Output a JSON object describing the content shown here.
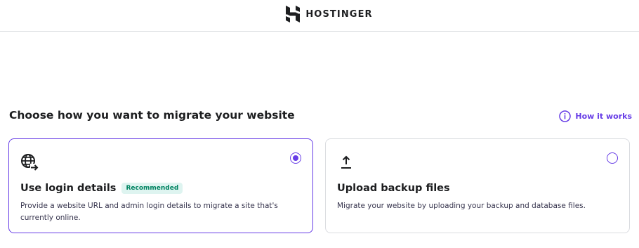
{
  "header": {
    "brand": "HOSTINGER",
    "logo_icon": "hostinger-logo-icon"
  },
  "section": {
    "title": "Choose how you want to migrate your website",
    "help_link": "How it works",
    "help_icon": "info-circle-icon"
  },
  "options": [
    {
      "title": "Use login details",
      "badge": "Recommended",
      "description": "Provide a website URL and admin login details to migrate a site that's currently online.",
      "icon": "globe-arrow-icon",
      "selected": true
    },
    {
      "title": "Upload backup files",
      "description": "Migrate your website by uploading your backup and database files.",
      "icon": "upload-arrow-icon",
      "selected": false
    }
  ],
  "colors": {
    "accent": "#673de6",
    "badge_bg": "#def4f0",
    "badge_text": "#008361",
    "border": "#dadce0",
    "text": "#1d1e20"
  }
}
